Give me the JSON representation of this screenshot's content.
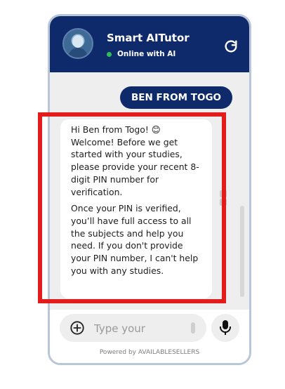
{
  "header": {
    "title": "Smart AITutor",
    "status_text": "Online with AI",
    "avatar_icon": "robot-avatar",
    "refresh_icon": "refresh-icon"
  },
  "chat": {
    "user_message": "BEN FROM TOGO",
    "bot_message_p1": "Hi Ben from Togo! 😊 Welcome! Before we get started with your studies, please provide your recent 8-digit PIN number for verification.",
    "bot_message_p2": "Once your PIN is verified, you’ll have full access to all the subjects and help you need. If you don't provide your PIN number, I can't help you with any studies."
  },
  "composer": {
    "placeholder": "Type your",
    "plus_icon": "plus-circle-icon",
    "mic_icon": "microphone-icon"
  },
  "footer": {
    "powered_by": "Powered by AVAILABLESELLERS"
  },
  "colors": {
    "header_bg": "#0f2a6b",
    "status_green": "#2fbf56",
    "highlight_red": "#e31b1b",
    "chat_bg": "#eeeeee"
  }
}
